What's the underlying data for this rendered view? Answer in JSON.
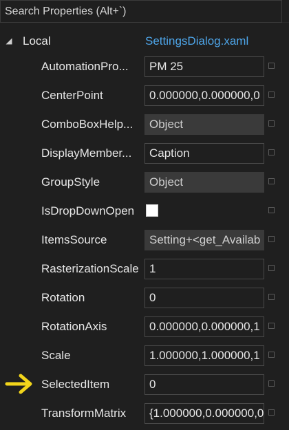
{
  "search": {
    "placeholder": "Search Properties (Alt+`)"
  },
  "section": {
    "label": "Local",
    "source_link": "SettingsDialog.xaml"
  },
  "properties": [
    {
      "name": "AutomationPro...",
      "value": "PM 25",
      "kind": "text"
    },
    {
      "name": "CenterPoint",
      "value": "0.000000,0.000000,0",
      "kind": "text"
    },
    {
      "name": "ComboBoxHelp...",
      "value": "Object",
      "kind": "readonly"
    },
    {
      "name": "DisplayMember...",
      "value": "Caption",
      "kind": "text"
    },
    {
      "name": "GroupStyle",
      "value": "Object",
      "kind": "readonly"
    },
    {
      "name": "IsDropDownOpen",
      "value": "",
      "kind": "checkbox"
    },
    {
      "name": "ItemsSource",
      "value": "Setting+<get_Availab",
      "kind": "readonly"
    },
    {
      "name": "RasterizationScale",
      "value": "1",
      "kind": "text"
    },
    {
      "name": "Rotation",
      "value": "0",
      "kind": "text"
    },
    {
      "name": "RotationAxis",
      "value": "0.000000,0.000000,1",
      "kind": "text"
    },
    {
      "name": "Scale",
      "value": "1.000000,1.000000,1",
      "kind": "text"
    },
    {
      "name": "SelectedItem",
      "value": "0",
      "kind": "text"
    },
    {
      "name": "TransformMatrix",
      "value": "{1.000000,0.000000,0",
      "kind": "text"
    }
  ],
  "annotation": {
    "icon": "yellow-arrow-icon",
    "color": "#f2d51b"
  },
  "colors": {
    "background": "#1f1f1f",
    "link": "#4ea6ea",
    "readonly_field": "#3a3a3a"
  }
}
